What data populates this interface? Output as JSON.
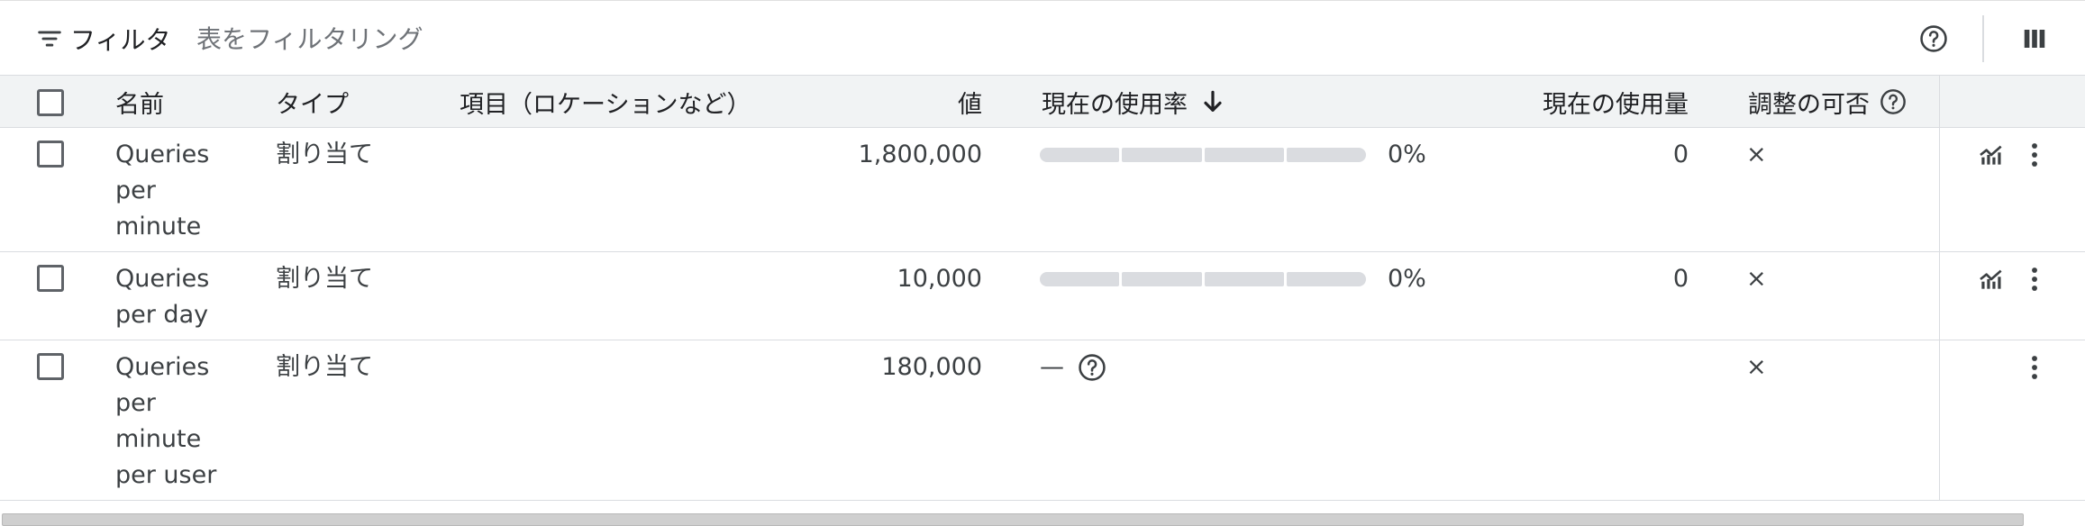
{
  "toolbar": {
    "filter_label": "フィルタ",
    "filter_placeholder": "表をフィルタリング"
  },
  "columns": {
    "name": "名前",
    "type": "タイプ",
    "dimensions": "項目（ロケーションなど）",
    "value": "値",
    "usage_pct": "現在の使用率",
    "usage": "現在の使用量",
    "adjustable": "調整の可否"
  },
  "rows": [
    {
      "name_lines": [
        "Queries",
        "per",
        "minute"
      ],
      "type": "割り当て",
      "value": "1,800,000",
      "usage_pct_label": "0%",
      "usage_pct": 0,
      "usage": "0",
      "adjustable": "×"
    },
    {
      "name_lines": [
        "Queries",
        "per day"
      ],
      "type": "割り当て",
      "value": "10,000",
      "usage_pct_label": "0%",
      "usage_pct": 0,
      "usage": "0",
      "adjustable": "×"
    },
    {
      "name_lines": [
        "Queries",
        "per",
        "minute",
        "per user"
      ],
      "type": "割り当て",
      "value": "180,000",
      "usage_pct_label": "—",
      "usage": "",
      "adjustable": "×"
    }
  ],
  "icons": {
    "filter": "filter-list-icon",
    "help": "help-circle-icon",
    "columns": "column-selector-icon",
    "sort": "arrow-down-icon",
    "chart": "monitoring-chart-icon",
    "more": "more-vert-icon"
  },
  "colors": {
    "header_bg": "#f1f3f4",
    "border": "#dadce0",
    "bar_track": "#dadce0",
    "text": "#3c4043"
  }
}
